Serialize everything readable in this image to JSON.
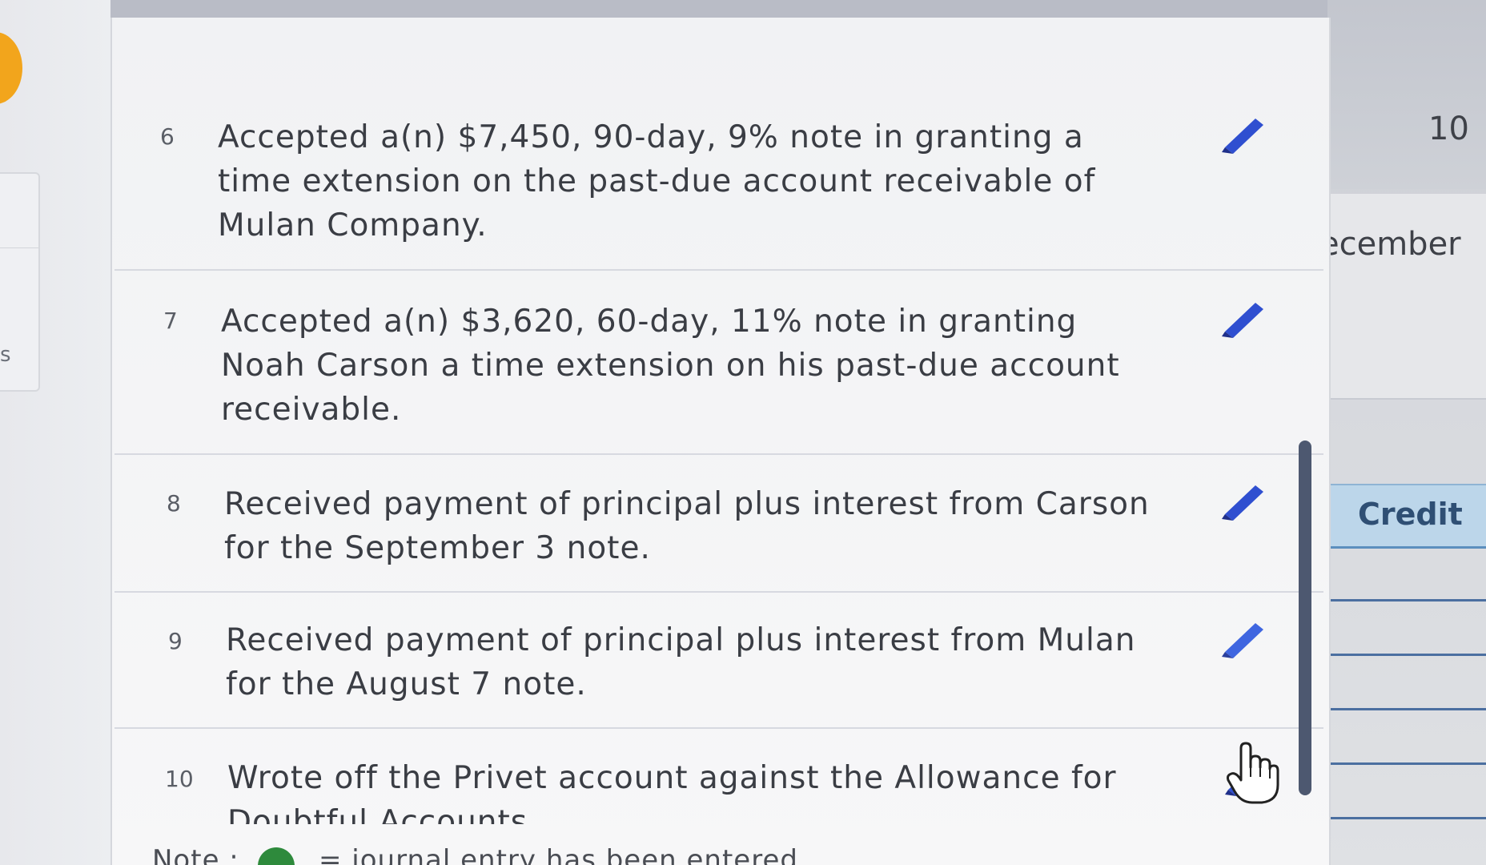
{
  "left_partial_label": "s",
  "column_header": {
    "number": "10",
    "month": "ecember",
    "credit_label": "Credit"
  },
  "transactions": [
    {
      "number": "6",
      "lines": [
        "Accepted a(n) $7,450, 90-day, 9% note in granting a",
        "time extension on the past-due account receivable of",
        "Mulan Company."
      ],
      "action_icon": "pencil-icon"
    },
    {
      "number": "7",
      "lines": [
        "Accepted a(n) $3,620, 60-day, 11% note in granting",
        "Noah Carson a time extension on his past-due account",
        "receivable."
      ],
      "action_icon": "pencil-icon"
    },
    {
      "number": "8",
      "lines": [
        "Received payment of principal plus interest from Carson",
        "for the September 3 note."
      ],
      "action_icon": "pencil-icon"
    },
    {
      "number": "9",
      "lines": [
        "Received payment of principal plus interest from Mulan",
        "for the August 7 note."
      ],
      "action_icon": "pencil-icon"
    },
    {
      "number": "10",
      "lines": [
        "Wrote off the Privet account against the Allowance for",
        "Doubtful Accounts"
      ],
      "action_icon": "pencil-icon"
    }
  ],
  "note": {
    "prefix": "Note :",
    "text": "= journal entry has been entered"
  },
  "colors": {
    "pencil": "#2f4fd0",
    "credit_header_bg": "#bcd6ea",
    "entry_line": "#4b6fa0",
    "scrollbar": "#4d5870"
  }
}
